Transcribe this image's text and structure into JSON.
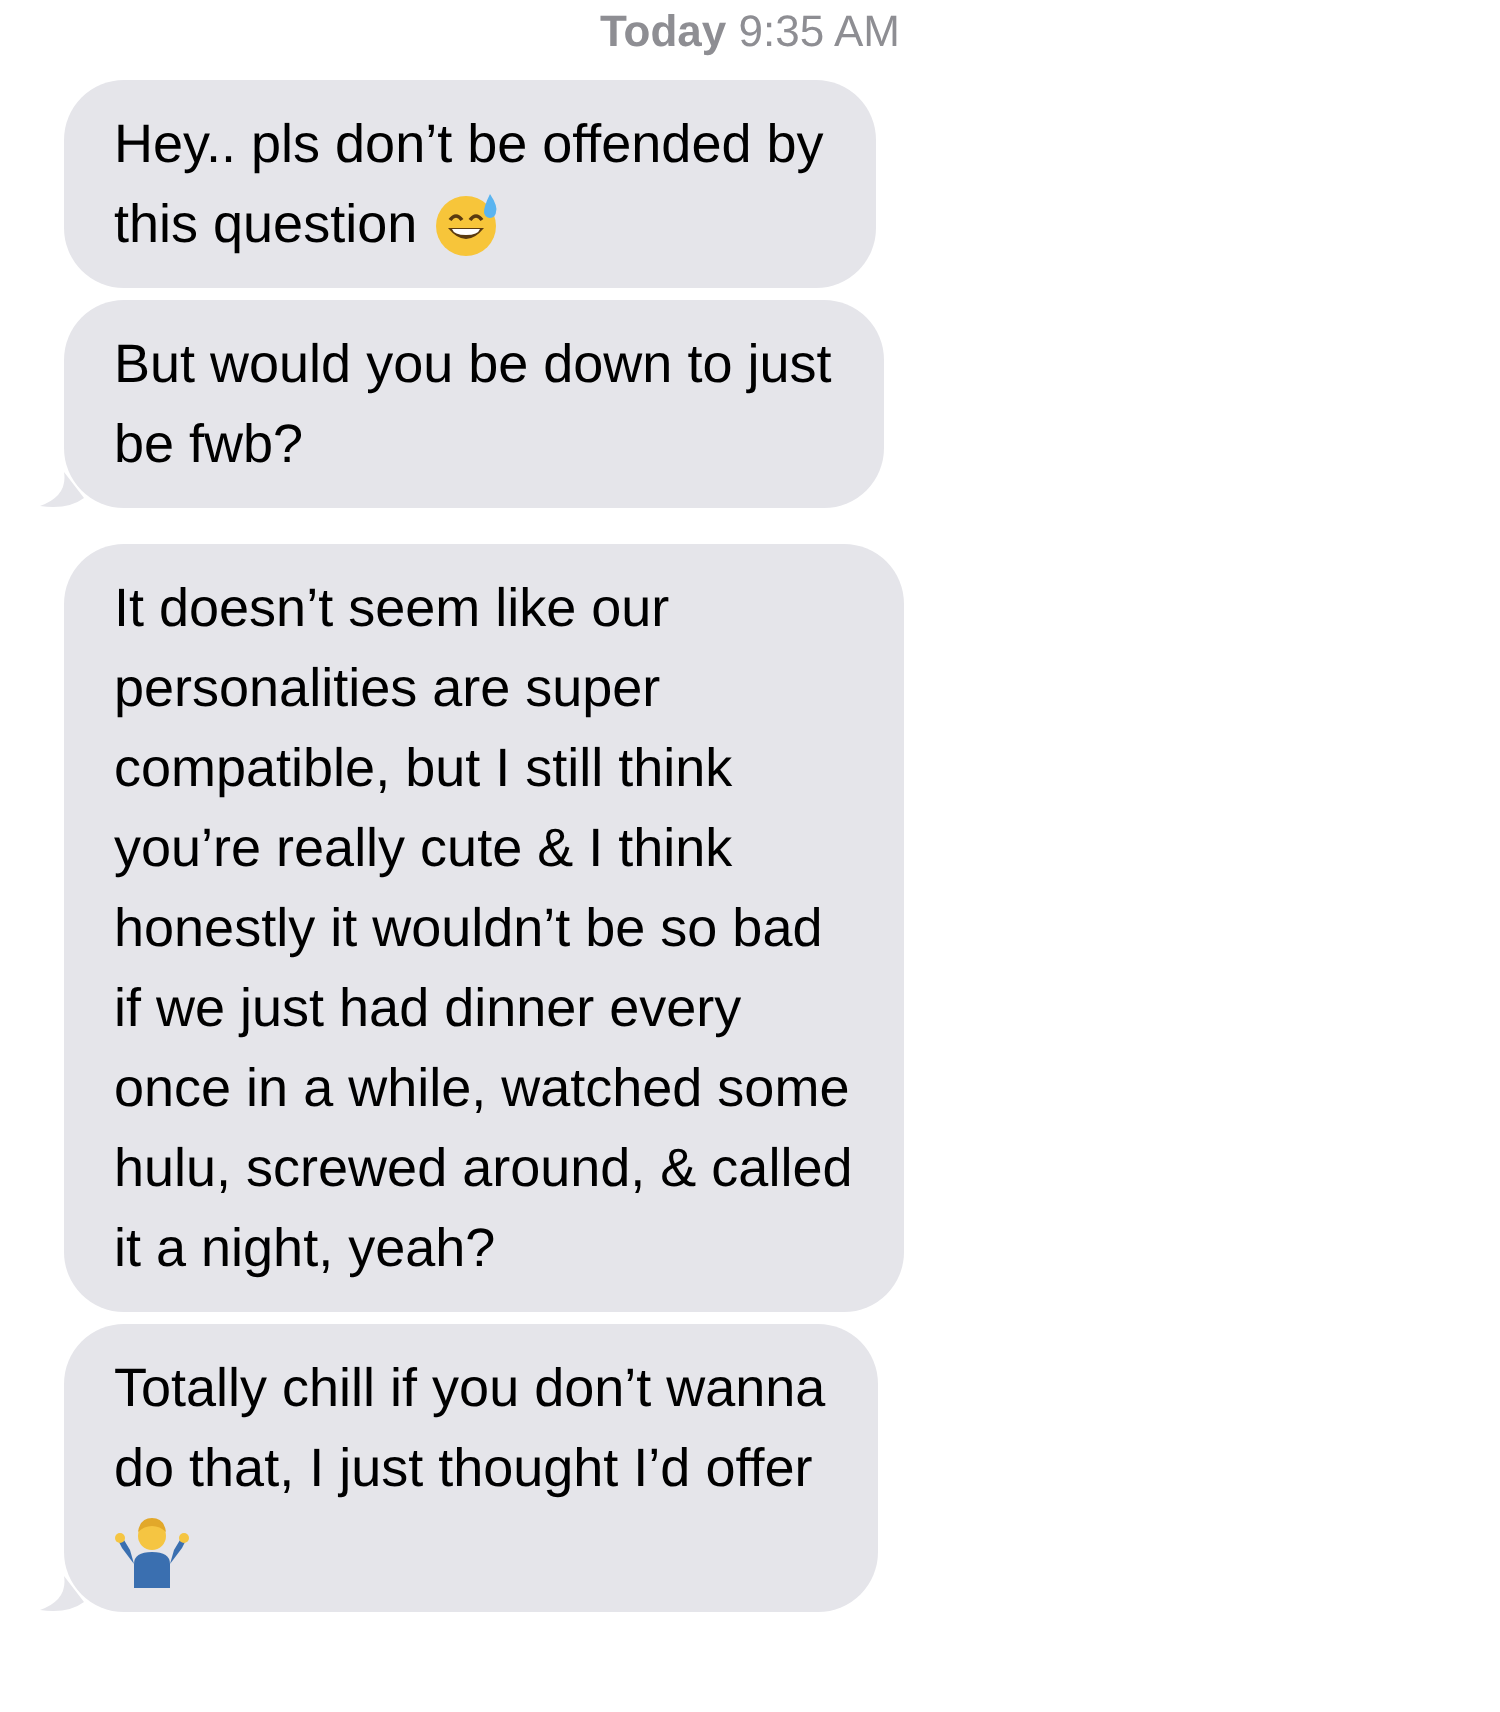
{
  "timestamp": "**Today** 9:35 AM",
  "messages": [
    {
      "lines": [
        "Hey.. pls don’t be offended by",
        "this question"
      ],
      "kind": "inline-emoji",
      "tail": false
    },
    {
      "lines": [
        "But would you be down to just",
        "be fwb?"
      ],
      "kind": "plain",
      "tail": true
    },
    {
      "lines": [
        "It doesn’t seem like our",
        "personalities are super",
        "compatible, but I still think",
        "you’re really cute & I think",
        "honestly it wouldn’t be so bad",
        "if we just had dinner every",
        "once in a while, watched some",
        "hulu, screwed around, & called",
        "it a night, yeah?"
      ],
      "kind": "plain",
      "tail": false
    },
    {
      "lines": [
        "Totally chill if you don’t wanna",
        "do that, I just thought I’d offer"
      ],
      "kind": "emoji-below",
      "tail": true
    }
  ]
}
